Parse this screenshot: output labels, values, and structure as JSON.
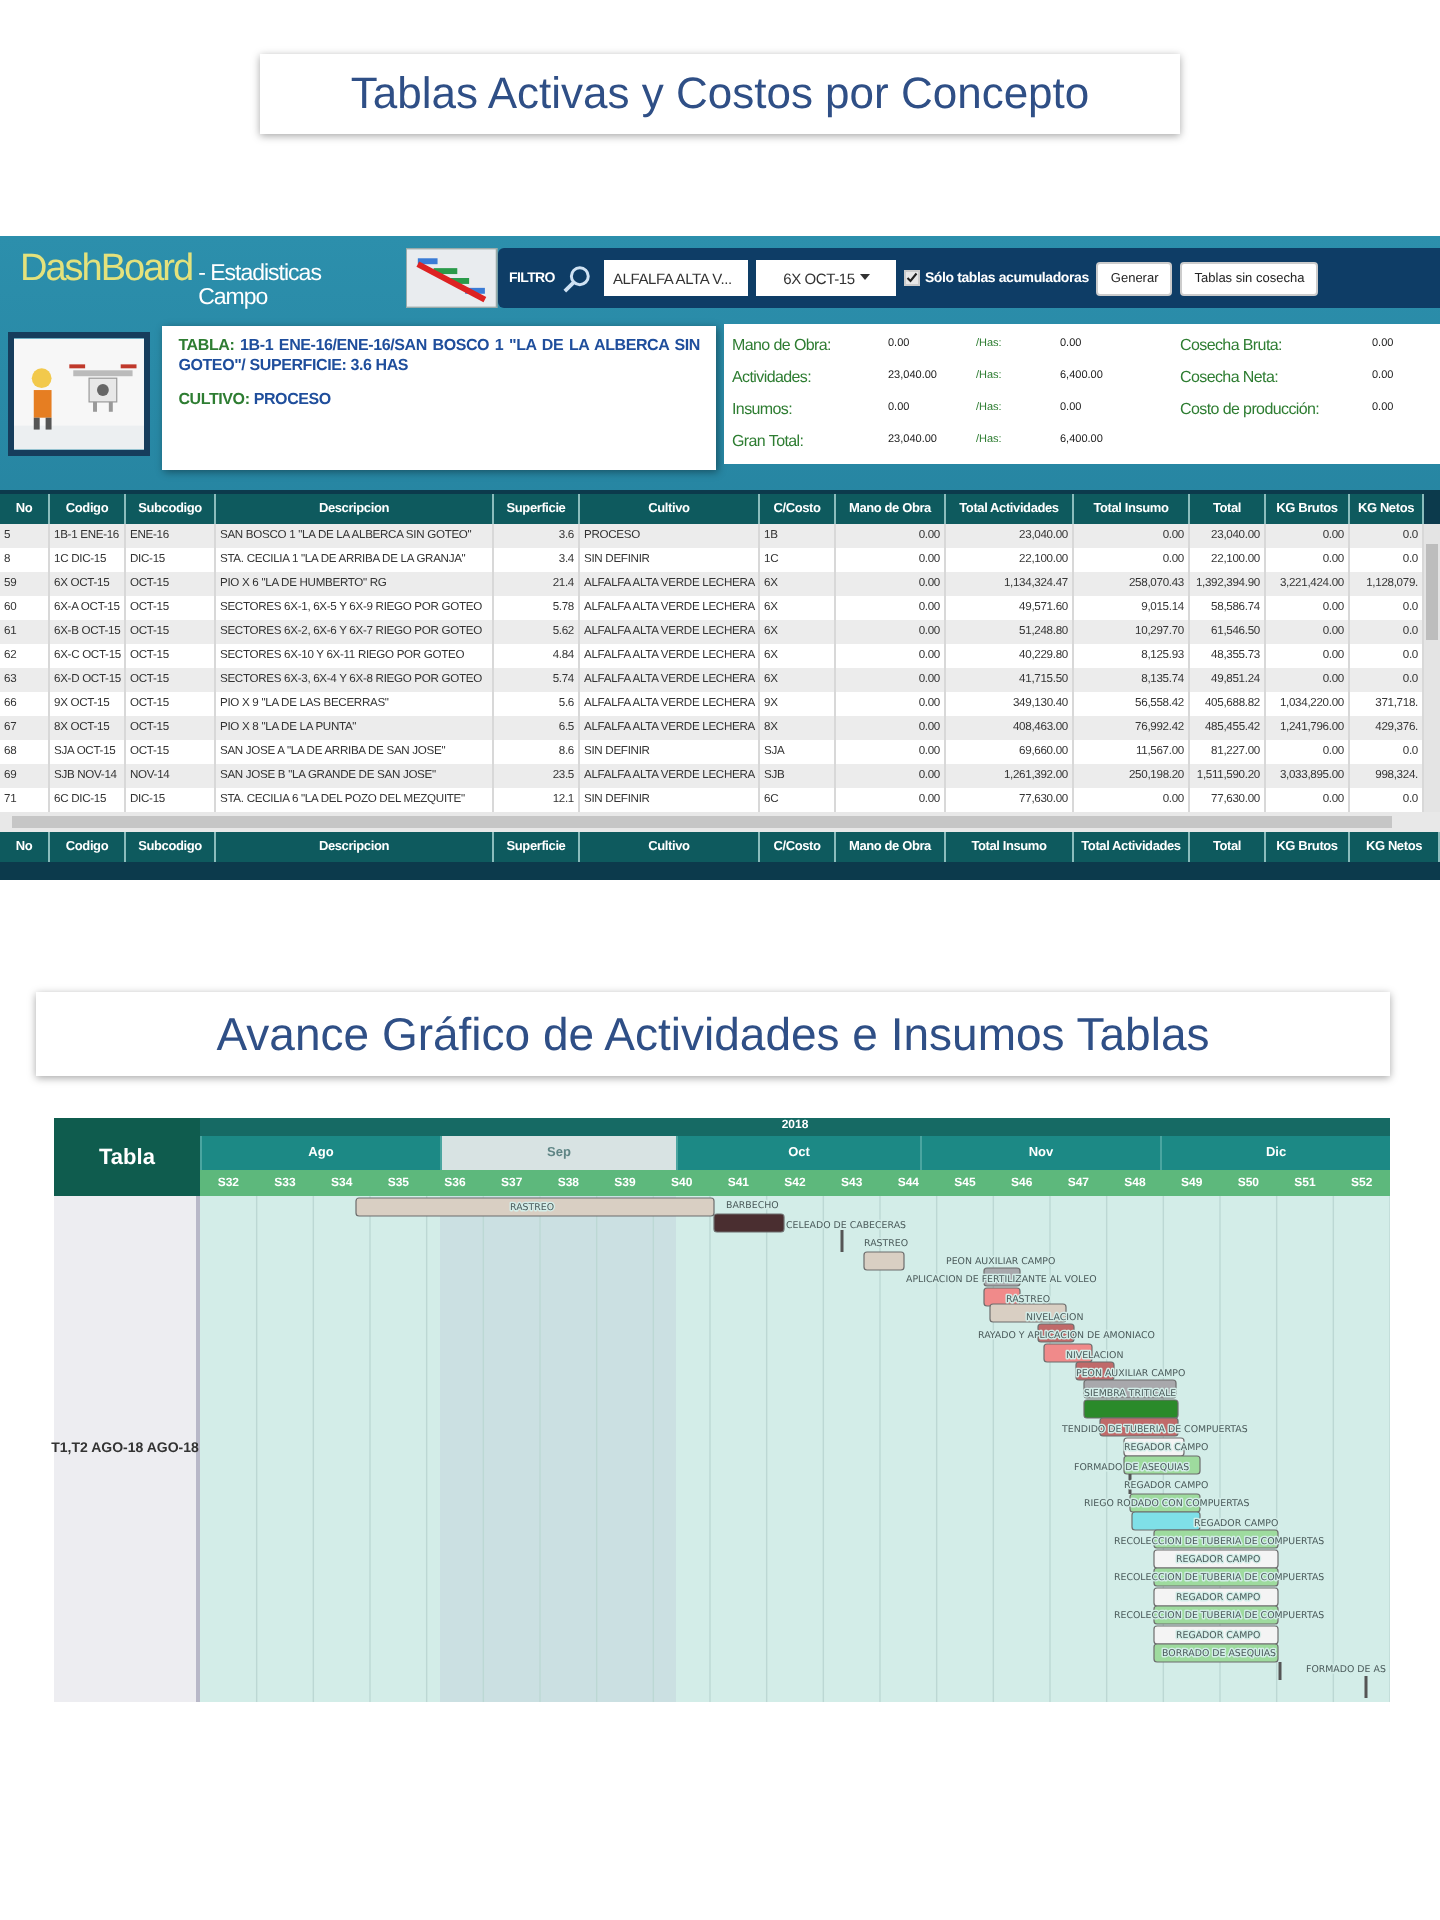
{
  "costs_heading": {
    "text": "Tablas Activas y Costos por Concepto"
  },
  "dashboard": {
    "brand": {
      "name": "DashBoard",
      "subtitle": "- Estadisticas Campo"
    },
    "filter": {
      "label": "FILTRO",
      "crop": "ALFALFA ALTA V...",
      "table": "6X OCT-15",
      "accumulating_only": {
        "label": "Sólo tablas acumuladoras",
        "checked": true
      },
      "buttons": [
        "Generar",
        "Tablas sin cosecha"
      ]
    },
    "summary": {
      "table": {
        "label": "TABLA:",
        "value": "1B-1 ENE-16/ENE-16/SAN BOSCO 1 \"LA DE LA ALBERCA SIN GOTEO\"/ SUPERFICIE: 3.6 HAS"
      },
      "crop": {
        "label": "CULTIVO:",
        "value": "PROCESO"
      }
    },
    "costs": [
      {
        "label": "Mano de Obra:",
        "value": "0.00",
        "per_ha_label": "/Has:",
        "per_ha": "0.00"
      },
      {
        "label": "Actividades:",
        "value": "23,040.00",
        "per_ha_label": "/Has:",
        "per_ha": "6,400.00"
      },
      {
        "label": "Insumos:",
        "value": "0.00",
        "per_ha_label": "/Has:",
        "per_ha": "0.00"
      },
      {
        "label": "Gran Total:",
        "value": "23,040.00",
        "per_ha_label": "/Has:",
        "per_ha": "6,400.00"
      }
    ],
    "harvest": [
      {
        "label": "Cosecha Bruta:",
        "value": "0.00"
      },
      {
        "label": "Cosecha Neta:",
        "value": "0.00"
      },
      {
        "label": "Costo de producción:",
        "value": "0.00"
      }
    ],
    "table": {
      "columns": [
        "No",
        "Codigo",
        "Subcodigo",
        "Descripcion",
        "Superficie",
        "Cultivo",
        "C/Costo",
        "Mano de Obra",
        "Total Actividades",
        "Total Insumo",
        "Total",
        "KG Brutos",
        "KG Netos"
      ],
      "rows": [
        [
          "5",
          "1B-1 ENE-16",
          "ENE-16",
          "SAN BOSCO 1 \"LA DE LA ALBERCA SIN GOTEO\"",
          "3.6",
          "PROCESO",
          "1B",
          "0.00",
          "23,040.00",
          "0.00",
          "23,040.00",
          "0.00",
          "0.0"
        ],
        [
          "8",
          "1C DIC-15",
          "DIC-15",
          "STA. CECILIA 1 \"LA DE ARRIBA DE LA GRANJA\"",
          "3.4",
          "SIN DEFINIR",
          "1C",
          "0.00",
          "22,100.00",
          "0.00",
          "22,100.00",
          "0.00",
          "0.0"
        ],
        [
          "59",
          "6X OCT-15",
          "OCT-15",
          "PIO X 6 \"LA DE HUMBERTO\" RG",
          "21.4",
          "ALFALFA ALTA VERDE LECHERA",
          "6X",
          "0.00",
          "1,134,324.47",
          "258,070.43",
          "1,392,394.90",
          "3,221,424.00",
          "1,128,079."
        ],
        [
          "60",
          "6X-A OCT-15",
          "OCT-15",
          "SECTORES 6X-1, 6X-5 Y 6X-9 RIEGO POR GOTEO",
          "5.78",
          "ALFALFA ALTA VERDE LECHERA",
          "6X",
          "0.00",
          "49,571.60",
          "9,015.14",
          "58,586.74",
          "0.00",
          "0.0"
        ],
        [
          "61",
          "6X-B OCT-15",
          "OCT-15",
          "SECTORES 6X-2, 6X-6 Y 6X-7 RIEGO POR GOTEO",
          "5.62",
          "ALFALFA ALTA VERDE LECHERA",
          "6X",
          "0.00",
          "51,248.80",
          "10,297.70",
          "61,546.50",
          "0.00",
          "0.0"
        ],
        [
          "62",
          "6X-C OCT-15",
          "OCT-15",
          "SECTORES 6X-10 Y 6X-11 RIEGO POR GOTEO",
          "4.84",
          "ALFALFA ALTA VERDE LECHERA",
          "6X",
          "0.00",
          "40,229.80",
          "8,125.93",
          "48,355.73",
          "0.00",
          "0.0"
        ],
        [
          "63",
          "6X-D OCT-15",
          "OCT-15",
          "SECTORES 6X-3, 6X-4 Y 6X-8 RIEGO POR GOTEO",
          "5.74",
          "ALFALFA ALTA VERDE LECHERA",
          "6X",
          "0.00",
          "41,715.50",
          "8,135.74",
          "49,851.24",
          "0.00",
          "0.0"
        ],
        [
          "66",
          "9X OCT-15",
          "OCT-15",
          "PIO X 9 \"LA DE LAS BECERRAS\"",
          "5.6",
          "ALFALFA ALTA VERDE LECHERA",
          "9X",
          "0.00",
          "349,130.40",
          "56,558.42",
          "405,688.82",
          "1,034,220.00",
          "371,718."
        ],
        [
          "67",
          "8X OCT-15",
          "OCT-15",
          "PIO X 8 \"LA DE LA PUNTA\"",
          "6.5",
          "ALFALFA ALTA VERDE LECHERA",
          "8X",
          "0.00",
          "408,463.00",
          "76,992.42",
          "485,455.42",
          "1,241,796.00",
          "429,376."
        ],
        [
          "68",
          "SJA OCT-15",
          "OCT-15",
          "SAN JOSE A \"LA DE ARRIBA DE SAN JOSE\"",
          "8.6",
          "SIN DEFINIR",
          "SJA",
          "0.00",
          "69,660.00",
          "11,567.00",
          "81,227.00",
          "0.00",
          "0.0"
        ],
        [
          "69",
          "SJB NOV-14",
          "NOV-14",
          "SAN JOSE B \"LA GRANDE DE SAN JOSE\"",
          "23.5",
          "ALFALFA ALTA VERDE LECHERA",
          "SJB",
          "0.00",
          "1,261,392.00",
          "250,198.20",
          "1,511,590.20",
          "3,033,895.00",
          "998,324."
        ],
        [
          "71",
          "6C DIC-15",
          "DIC-15",
          "STA. CECILIA 6 \"LA DEL POZO DEL MEZQUITE\"",
          "12.1",
          "SIN DEFINIR",
          "6C",
          "0.00",
          "77,630.00",
          "0.00",
          "77,630.00",
          "0.00",
          "0.0"
        ]
      ],
      "footer_columns": [
        "No",
        "Codigo",
        "Subcodigo",
        "Descripcion",
        "Superficie",
        "Cultivo",
        "C/Costo",
        "Mano de Obra",
        "Total Insumo",
        "Total Actividades",
        "Total",
        "KG Brutos",
        "KG Netos"
      ]
    }
  },
  "progress_heading": {
    "text": "Avance Gráfico de Actividades e Insumos Tablas"
  },
  "gantt": {
    "header": "Tabla",
    "year": "2018",
    "row_label": "T1,T2 AGO-18 AGO-18",
    "months": [
      {
        "label": "Ago",
        "selected": false
      },
      {
        "label": "Sep",
        "selected": true
      },
      {
        "label": "Oct",
        "selected": false
      },
      {
        "label": "Nov",
        "selected": false
      },
      {
        "label": "Dic",
        "selected": false
      }
    ],
    "weeks": [
      "S32",
      "S33",
      "S34",
      "S35",
      "S36",
      "S37",
      "S38",
      "S39",
      "S40",
      "S41",
      "S42",
      "S43",
      "S44",
      "S45",
      "S46",
      "S47",
      "S48",
      "S49",
      "S50",
      "S51",
      "S52"
    ],
    "tasks": [
      {
        "kind": "bar",
        "label": "RASTREO",
        "color": "#d9cfc3"
      },
      {
        "kind": "bar",
        "label": "BARBECHO",
        "color": "#4a2e30"
      },
      {
        "kind": "milestone",
        "label": "CELEADO DE CABECERAS",
        "color": "#555555"
      },
      {
        "kind": "bar",
        "label": "RASTREO",
        "color": "#d9cfc3"
      },
      {
        "kind": "bar",
        "label": "PEON AUXILIAR CAMPO",
        "color": "#a8a8ac"
      },
      {
        "kind": "bar",
        "label": "APLICACION DE FERTILIZANTE AL VOLEO",
        "color": "#f08a8a"
      },
      {
        "kind": "bar",
        "label": "RASTREO",
        "color": "#d9cfc3"
      },
      {
        "kind": "bar",
        "label": "NIVELACION",
        "color": "#c06a6a"
      },
      {
        "kind": "bar",
        "label": "RAYADO Y APLICACION DE AMONIACO",
        "color": "#f08a8a"
      },
      {
        "kind": "bar",
        "label": "NIVELACION",
        "color": "#c06a6a"
      },
      {
        "kind": "bar",
        "label": "PEON AUXILIAR CAMPO",
        "color": "#a8a8ac"
      },
      {
        "kind": "bar",
        "label": "SIEMBRA TRITICALE",
        "color": "#2a8a2a"
      },
      {
        "kind": "bar",
        "label": "TENDIDO DE TUBERIA DE COMPUERTAS",
        "color": "#c06a6a"
      },
      {
        "kind": "bar",
        "label": "REGADOR CAMPO",
        "color": "#f4f4f4"
      },
      {
        "kind": "bar",
        "label": "FORMADO DE ASEQUIAS",
        "color": "#9edb9e"
      },
      {
        "kind": "milestone",
        "label": "REGADOR CAMPO",
        "color": "#555555"
      },
      {
        "kind": "bar",
        "label": "RIEGO RODADO CON COMPUERTAS",
        "color": "#9edb9e"
      },
      {
        "kind": "bar",
        "label": "REGADOR CAMPO",
        "color": "#7fe0e8"
      },
      {
        "kind": "bar",
        "label": "RECOLECCION DE TUBERIA DE COMPUERTAS",
        "color": "#9edb9e"
      },
      {
        "kind": "bar",
        "label": "REGADOR CAMPO",
        "color": "#f4f4f4"
      },
      {
        "kind": "bar",
        "label": "RECOLECCION DE TUBERIA DE COMPUERTAS",
        "color": "#9edb9e"
      },
      {
        "kind": "bar",
        "label": "REGADOR CAMPO",
        "color": "#f4f4f4"
      },
      {
        "kind": "bar",
        "label": "RECOLECCION DE TUBERIA DE COMPUERTAS",
        "color": "#9edb9e"
      },
      {
        "kind": "bar",
        "label": "REGADOR CAMPO",
        "color": "#f4f4f4"
      },
      {
        "kind": "bar",
        "label": "BORRADO DE ASEQUIAS",
        "color": "#9edb9e"
      },
      {
        "kind": "milestone",
        "color": "#555555"
      },
      {
        "kind": "milestone",
        "label": "FORMADO DE AS",
        "color": "#555555"
      }
    ]
  }
}
